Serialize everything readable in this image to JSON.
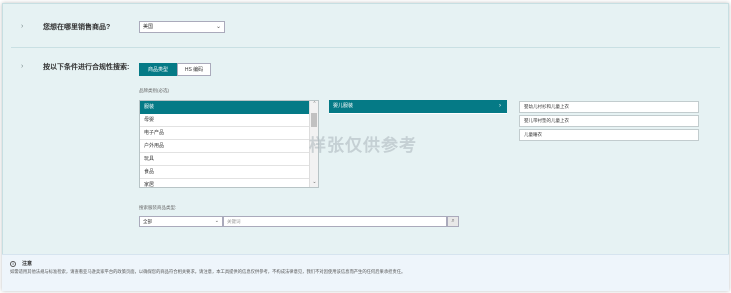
{
  "q1": {
    "label": "您想在哪里销售商品?",
    "select_value": "美国"
  },
  "q2": {
    "label": "按以下条件进行合规性搜索:"
  },
  "tabs": [
    {
      "label": "商品类型"
    },
    {
      "label": "HS 编码"
    }
  ],
  "category_label": "品牌类别(必选)",
  "category_list": [
    {
      "label": "服装",
      "selected": true
    },
    {
      "label": "母婴"
    },
    {
      "label": "电子产品"
    },
    {
      "label": "户外用品"
    },
    {
      "label": "玩具"
    },
    {
      "label": "食品"
    },
    {
      "label": "家居"
    }
  ],
  "subcategory_list": [
    {
      "label": "婴儿服装",
      "selected": true
    }
  ],
  "leaf_items": [
    {
      "label": "婴幼儿衬衫和儿童上衣"
    },
    {
      "label": "婴儿带衬垫的儿童上衣"
    },
    {
      "label": "儿童睡衣"
    }
  ],
  "search": {
    "label": "搜索服装商品类型:",
    "scope_value": "全部",
    "keyword_placeholder": "关键词"
  },
  "notice": {
    "icon": "info-icon",
    "title": "注意",
    "body": "如需适用其他法规与标准检索，请查看亚马逊卖家平台的政策页面，以确保您的商品符合相关要求。请注意，本工具提供的信息仅供参考，不构成法律意见，我们不对因使用该信息而产生的任何后果承担责任。"
  },
  "watermark": "样张仅供参考"
}
